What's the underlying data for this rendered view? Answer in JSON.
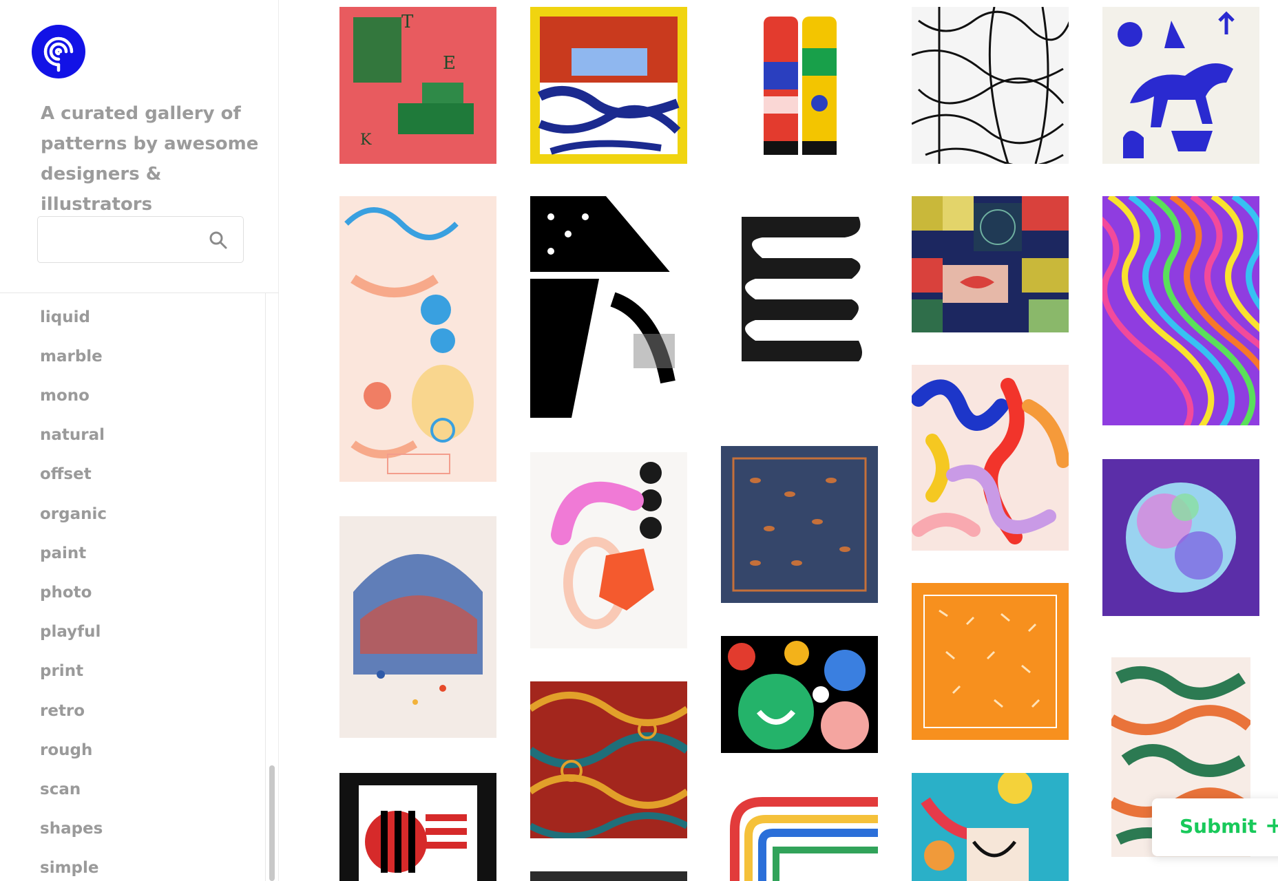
{
  "sidebar": {
    "tagline": "A curated gallery of patterns by awesome designers & illustrators",
    "search": {
      "value": "",
      "placeholder": ""
    },
    "tags": [
      "liquid",
      "marble",
      "mono",
      "natural",
      "offset",
      "organic",
      "paint",
      "photo",
      "playful",
      "print",
      "retro",
      "rough",
      "scan",
      "shapes",
      "simple"
    ]
  },
  "gallery": {
    "tiles": [
      {
        "name": "tile-pink-green-collage",
        "colors": [
          "#e85b5f",
          "#1f7a3a"
        ]
      },
      {
        "name": "tile-yellow-frame-bedroom",
        "colors": [
          "#f0d410",
          "#c93a1e",
          "#1b2a8f"
        ]
      },
      {
        "name": "tile-socks",
        "colors": [
          "#e33b2e",
          "#f3c500",
          "#2a3fbf"
        ]
      },
      {
        "name": "tile-bw-figures",
        "colors": [
          "#111111",
          "#f5f5f5"
        ]
      },
      {
        "name": "tile-blue-horse",
        "colors": [
          "#2a2ad0",
          "#f3f1ea"
        ]
      },
      {
        "name": "tile-pastel-swirls",
        "colors": [
          "#f7a98a",
          "#39a0e0",
          "#f9d27a"
        ]
      },
      {
        "name": "tile-bw-abstract",
        "colors": [
          "#000000",
          "#ffffff"
        ]
      },
      {
        "name": "tile-black-squiggle",
        "colors": [
          "#1a1a1a",
          "#ffffff"
        ]
      },
      {
        "name": "tile-geometric-grid",
        "colors": [
          "#c9b83a",
          "#1c2760",
          "#d9413c"
        ]
      },
      {
        "name": "tile-rainbow-waves",
        "colors": [
          "#f24a9b",
          "#f9e22f",
          "#37c1f2",
          "#8f3de0"
        ]
      },
      {
        "name": "tile-pink-ring-shapes",
        "colors": [
          "#f07ad6",
          "#f45a2e",
          "#1a1a1a"
        ]
      },
      {
        "name": "tile-navy-scarf",
        "colors": [
          "#35466a",
          "#c5703a"
        ]
      },
      {
        "name": "tile-colorful-worms",
        "colors": [
          "#f2342b",
          "#1d36c9",
          "#f5c821"
        ]
      },
      {
        "name": "tile-purple-sphere",
        "colors": [
          "#5b2ea8",
          "#9ad3f0"
        ]
      },
      {
        "name": "tile-splatter-arch",
        "colors": [
          "#2f5aa8",
          "#e64a2a"
        ]
      },
      {
        "name": "tile-smiley-circles",
        "colors": [
          "#000000",
          "#24b36a",
          "#3a7fe0",
          "#f4a5a0"
        ]
      },
      {
        "name": "tile-orange-scarf",
        "colors": [
          "#f7901e",
          "#ffffff"
        ]
      },
      {
        "name": "tile-ethnic-pattern",
        "colors": [
          "#a3261d",
          "#1f6f7a",
          "#e2a02a"
        ]
      },
      {
        "name": "tile-green-orange-paper",
        "colors": [
          "#2c7a52",
          "#e9733a"
        ]
      },
      {
        "name": "tile-apollo-stamp",
        "colors": [
          "#d62a2a",
          "#000000"
        ]
      },
      {
        "name": "tile-watercolor-rainbow",
        "colors": [
          "#e23b3b",
          "#f5c13a",
          "#2b6fd9"
        ]
      },
      {
        "name": "tile-collage-illustration",
        "colors": [
          "#2ab0c8",
          "#f4d23a",
          "#e63a4a"
        ]
      },
      {
        "name": "tile-dark-partial",
        "colors": [
          "#2a2a2a"
        ]
      }
    ]
  },
  "submit": {
    "label": "Submit",
    "plus": "+"
  },
  "icons": {
    "logo": "spiral-logo-icon",
    "search": "search-icon"
  },
  "colors": {
    "brand": "#1212e6",
    "accent": "#18c95a",
    "tag_text": "#9a9a9a"
  }
}
